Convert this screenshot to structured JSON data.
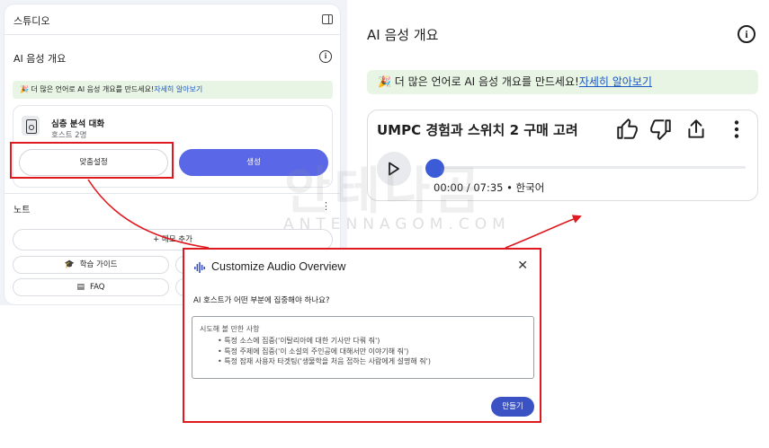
{
  "studio": {
    "title": "스튜디오",
    "audio_overview": {
      "title": "AI 음성 개요",
      "banner_text": "🎉 더 많은 언어로 AI 음성 개요를 만드세요!",
      "banner_link": "자세히 알아보기",
      "card_title": "심층 분석 대화",
      "card_subtitle": "호스트 2명",
      "customize_label": "맞춤설정",
      "generate_label": "생성"
    },
    "notes": {
      "title": "노트",
      "add_memo": "+ 메모 추가",
      "study_guide": "학습 가이드",
      "faq": "FAQ"
    }
  },
  "overview_panel": {
    "title": "AI 음성 개요",
    "banner_text": "🎉 더 많은 언어로 AI 음성 개요를 만드세요!",
    "banner_link": "자세히 알아보기",
    "track_title": "UMPC 경험과 스위치 2 구매 고려",
    "time": "00:00 / 07:35 • 한국어",
    "progress": 0
  },
  "dialog": {
    "title": "Customize Audio Overview",
    "question": "AI 호스트가 어떤 부분에 집중해야 하나요?",
    "tips_header": "시도해 볼 만한 사항",
    "tips": [
      "특정 소스에 집중('이탈리아에 대한 기사만 다뤄 줘')",
      "특정 주제에 집중('이 소설의 주인공에 대해서만 이야기해 줘')",
      "특정 잠재 사용자 타겟팅('생물학을 처음 접하는 사람에게 설명해 줘')"
    ],
    "create_label": "만들기"
  },
  "watermark": {
    "main": "안테나곰",
    "sub": "ANTENNAGOM.COM"
  },
  "colors": {
    "accent": "#5a68e8",
    "highlight": "#e0181f",
    "banner_bg": "#e8f5e4"
  }
}
